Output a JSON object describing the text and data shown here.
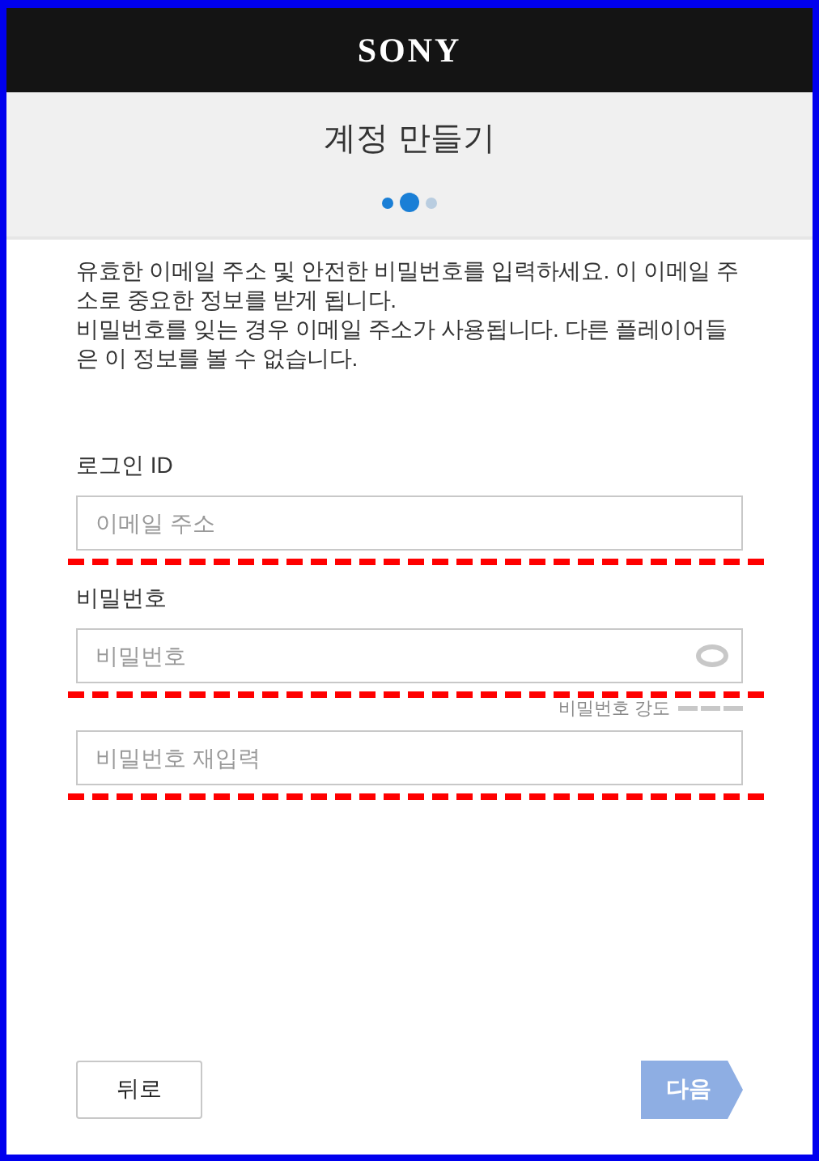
{
  "header": {
    "logo": "SONY"
  },
  "title": "계정 만들기",
  "steps": [
    {
      "selected": false,
      "done": true
    },
    {
      "selected": true
    },
    {
      "selected": false,
      "done": false
    }
  ],
  "intro": [
    "유효한 이메일 주소 및 안전한 비밀번호를 입력하세요. 이 이메일 주소로 중요한 정보를 받게 됩니다.",
    "비밀번호를 잊는 경우 이메일 주소가 사용됩니다. 다른 플레이어들은 이 정보를 볼 수 없습니다."
  ],
  "fields": [
    {
      "kind": "email",
      "label": "로그인 ID",
      "placeholder": "이메일 주소",
      "marked": true
    },
    {
      "kind": "password",
      "label": "비밀번호",
      "placeholder": "비밀번호",
      "marked": true,
      "strength_label": "비밀번호 강도"
    },
    {
      "kind": "confirm",
      "placeholder": "비밀번호 재입력",
      "marked": true
    }
  ],
  "buttons": {
    "back": "뒤로",
    "next": {
      "label": "다음",
      "disabled": true
    }
  }
}
